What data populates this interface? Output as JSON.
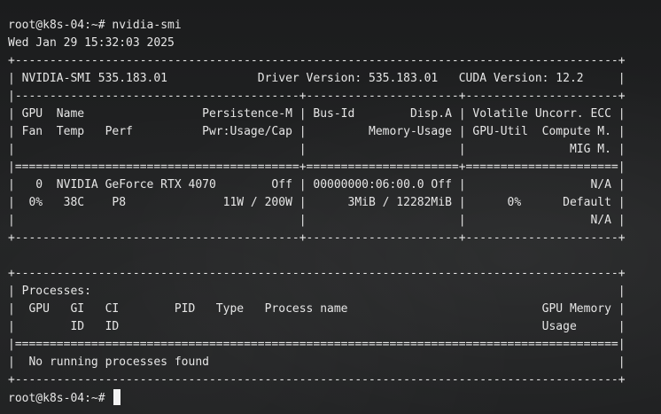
{
  "terminal": {
    "prompt": "root@k8s-04:~#",
    "command": "nvidia-smi",
    "lines": [
      "Wed Jan 29 15:32:03 2025",
      "+---------------------------------------------------------------------------------------+",
      "| NVIDIA-SMI 535.183.01             Driver Version: 535.183.01   CUDA Version: 12.2     |",
      "|-----------------------------------------+----------------------+----------------------+",
      "| GPU  Name                 Persistence-M | Bus-Id        Disp.A | Volatile Uncorr. ECC |",
      "| Fan  Temp   Perf          Pwr:Usage/Cap |         Memory-Usage | GPU-Util  Compute M. |",
      "|                                         |                      |               MIG M. |",
      "|=========================================+======================+======================|",
      "|   0  NVIDIA GeForce RTX 4070        Off | 00000000:06:00.0 Off |                  N/A |",
      "|  0%   38C    P8              11W / 200W |      3MiB / 12282MiB |      0%      Default |",
      "|                                         |                      |                  N/A |",
      "+-----------------------------------------+----------------------+----------------------+",
      "",
      "+---------------------------------------------------------------------------------------+",
      "| Processes:                                                                            |",
      "|  GPU   GI   CI        PID   Type   Process name                            GPU Memory |",
      "|        ID   ID                                                             Usage      |",
      "|=======================================================================================|",
      "|  No running processes found                                                           |",
      "+---------------------------------------------------------------------------------------+"
    ],
    "final_prompt": "root@k8s-04:~#"
  }
}
